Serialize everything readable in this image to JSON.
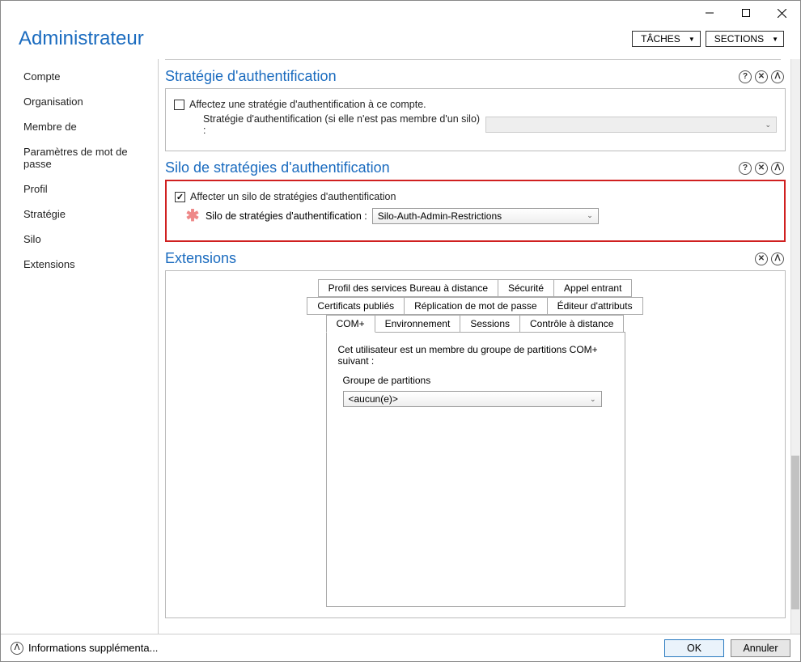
{
  "window": {
    "title": ""
  },
  "header": {
    "title": "Administrateur",
    "tasks_label": "TÂCHES",
    "sections_label": "SECTIONS"
  },
  "sidebar": {
    "items": [
      {
        "label": "Compte"
      },
      {
        "label": "Organisation"
      },
      {
        "label": "Membre de"
      },
      {
        "label": "Paramètres de mot de passe"
      },
      {
        "label": "Profil"
      },
      {
        "label": "Stratégie"
      },
      {
        "label": "Silo"
      },
      {
        "label": "Extensions"
      }
    ]
  },
  "sections": {
    "authPolicy": {
      "title": "Stratégie d'authentification",
      "checkbox_label": "Affectez une stratégie d'authentification à ce compte.",
      "field_label": "Stratégie d'authentification (si elle n'est pas membre d'un silo) :",
      "dropdown_value": ""
    },
    "silo": {
      "title": "Silo de stratégies d'authentification",
      "checkbox_label": "Affecter un silo de stratégies d'authentification",
      "field_label": "Silo de stratégies d'authentification :",
      "dropdown_value": "Silo-Auth-Admin-Restrictions"
    },
    "extensions": {
      "title": "Extensions",
      "tabs_row1": [
        "Profil des services Bureau à distance",
        "Sécurité",
        "Appel entrant"
      ],
      "tabs_row2": [
        "Certificats publiés",
        "Réplication de mot de passe",
        "Éditeur d'attributs"
      ],
      "tabs_row3": [
        "COM+",
        "Environnement",
        "Sessions",
        "Contrôle à distance"
      ],
      "com": {
        "description": "Cet utilisateur est un membre du groupe de partitions COM+ suivant :",
        "group_label": "Groupe de partitions",
        "group_value": "<aucun(e)>"
      }
    }
  },
  "footer": {
    "info_label": "Informations supplémenta...",
    "ok_label": "OK",
    "cancel_label": "Annuler"
  }
}
